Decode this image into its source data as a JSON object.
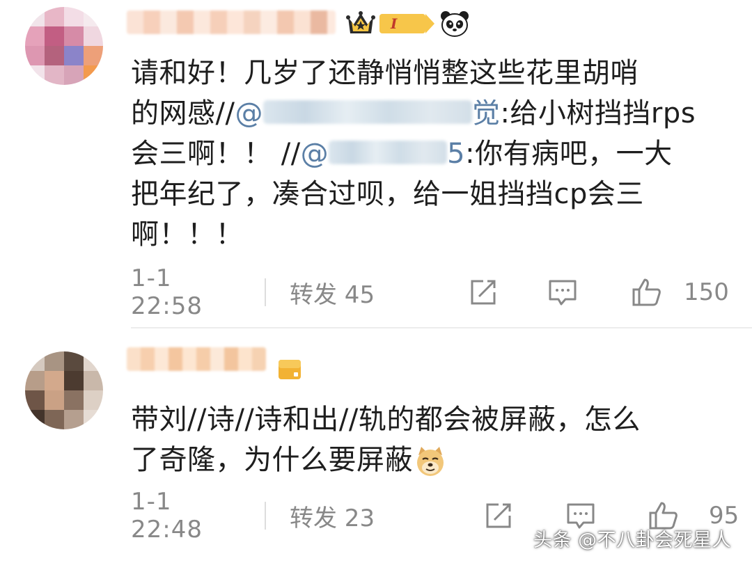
{
  "comments": [
    {
      "level_label": "I",
      "text_lines": [
        "请和好！几岁了还静悄悄整这些花里胡哨"
      ],
      "line2_prefix": "的网感//",
      "mention1_start": "@",
      "mention1_end": "觉",
      "line2_suffix": ":给小树挡挡rps",
      "line3_prefix": "会三啊！！ //",
      "mention2_start": "@",
      "mention2_end": "5",
      "line3_suffix": ":你有病吧，一大",
      "line4": "把年纪了，凑合过呗，给一姐挡挡cp会三",
      "line5": "啊！！！",
      "time": "1-1 22:58",
      "repost": "转发 45",
      "likes": "150"
    },
    {
      "line1": "带刘//诗//诗和出//轨的都会被屏蔽，怎么",
      "line2": "了奇隆，为什么要屏蔽",
      "time": "1-1 22:48",
      "repost": "转发 23",
      "likes": "95"
    }
  ],
  "icons": {
    "crown": "crown-icon",
    "panda": "panda-icon",
    "member": "member-card-icon",
    "doge": "doge-emoji-icon",
    "share": "share-icon",
    "reply": "reply-icon",
    "like": "thumbs-up-icon"
  },
  "watermark": "头条 @不八卦会死星人",
  "colors": {
    "mention": "#5b7fa6",
    "meta_text": "#888888",
    "badge_gold": "#f7c64a",
    "badge_red": "#c0392b"
  }
}
